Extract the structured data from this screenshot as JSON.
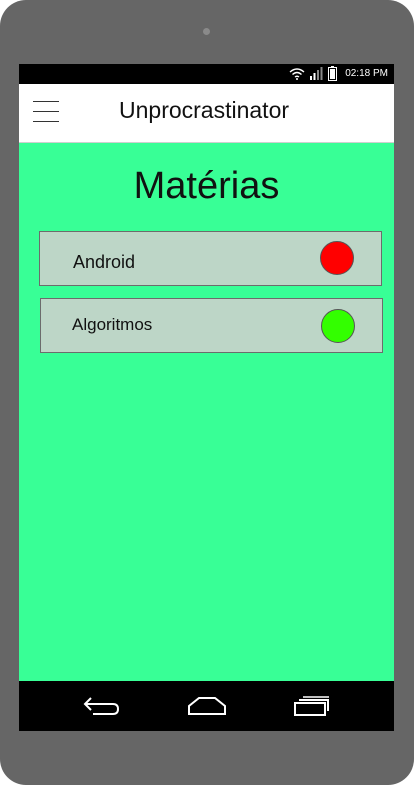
{
  "status_bar": {
    "time": "02:18 PM",
    "icons": [
      "wifi-icon",
      "signal-icon",
      "battery-icon"
    ]
  },
  "app_bar": {
    "title": "Unprocrastinator",
    "menu_icon": "menu-icon"
  },
  "main": {
    "title": "Matérias",
    "subjects": [
      {
        "name": "Android",
        "status_color": "#ff0000"
      },
      {
        "name": "Algoritmos",
        "status_color": "#33ff00"
      }
    ]
  },
  "navigation_bar": {
    "icons": [
      "back-icon",
      "home-icon",
      "recents-icon"
    ]
  },
  "colors": {
    "background": "#38ff96",
    "card": "#bdd6c7",
    "device_frame": "#666666"
  }
}
